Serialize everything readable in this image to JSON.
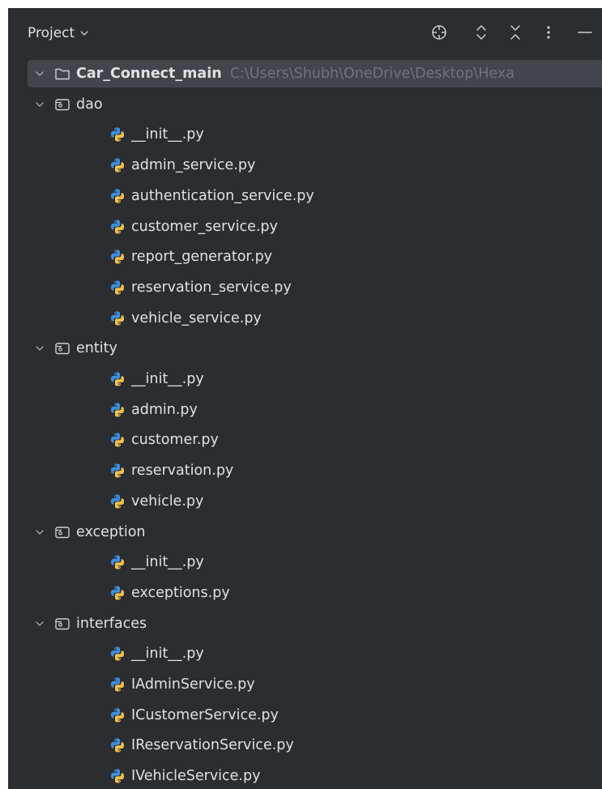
{
  "header": {
    "title": "Project",
    "icons": [
      "crosshair-icon",
      "expand-all-icon",
      "collapse-all-icon",
      "more-icon",
      "minimize-icon"
    ]
  },
  "tree": {
    "root": {
      "name": "Car_Connect_main",
      "path": "C:\\Users\\Shubh\\OneDrive\\Desktop\\Hexa"
    },
    "folders": [
      {
        "name": "dao",
        "files": [
          "__init__.py",
          "admin_service.py",
          "authentication_service.py",
          "customer_service.py",
          "report_generator.py",
          "reservation_service.py",
          "vehicle_service.py"
        ]
      },
      {
        "name": "entity",
        "files": [
          "__init__.py",
          "admin.py",
          "customer.py",
          "reservation.py",
          "vehicle.py"
        ]
      },
      {
        "name": "exception",
        "files": [
          "__init__.py",
          "exceptions.py"
        ]
      },
      {
        "name": "interfaces",
        "files": [
          "__init__.py",
          "IAdminService.py",
          "ICustomerService.py",
          "IReservationService.py",
          "IVehicleService.py"
        ]
      }
    ]
  },
  "colors": {
    "panel_bg": "#2b2d30",
    "selection_bg": "#43454a",
    "text": "#dfe1e5",
    "muted_text": "#6f737a",
    "python_blue": "#3d8ee0",
    "python_yellow": "#f2c14e"
  }
}
